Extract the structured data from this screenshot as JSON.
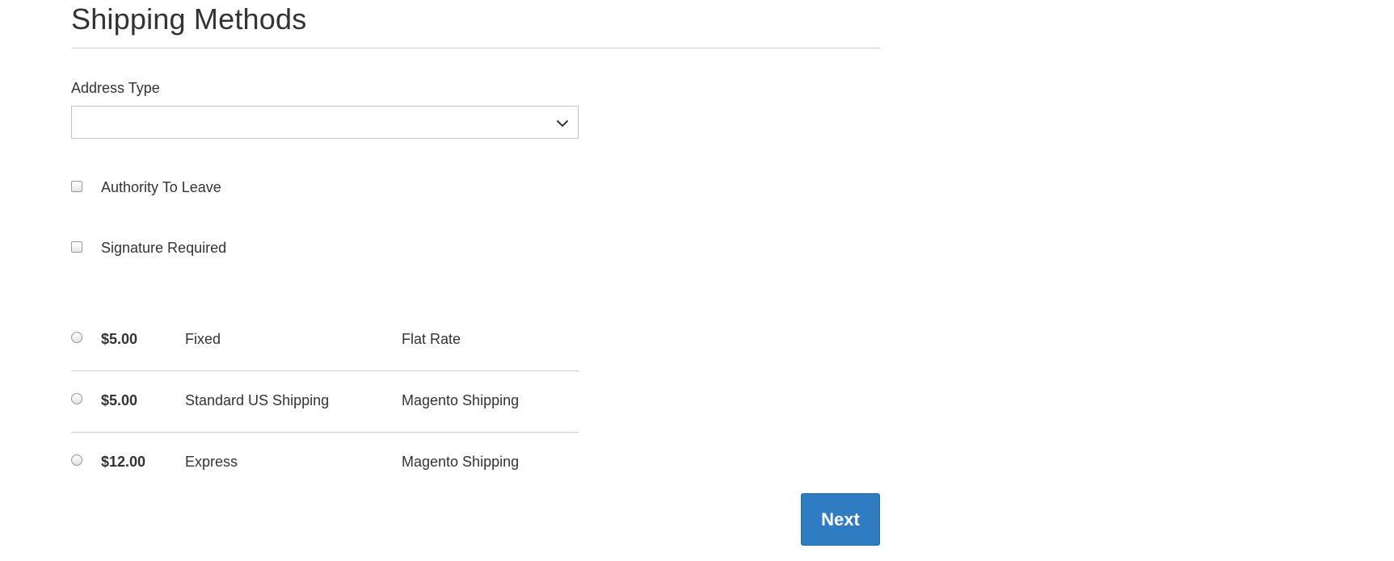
{
  "section": {
    "title": "Shipping Methods"
  },
  "address_type": {
    "label": "Address Type",
    "selected_value": "",
    "icon": "chevron-down-icon"
  },
  "options": {
    "authority_to_leave": {
      "label": "Authority To Leave",
      "checked": false
    },
    "signature_required": {
      "label": "Signature Required",
      "checked": false
    }
  },
  "shipping_rates": [
    {
      "price": "$5.00",
      "method": "Fixed",
      "carrier": "Flat Rate",
      "selected": false
    },
    {
      "price": "$5.00",
      "method": "Standard US Shipping",
      "carrier": "Magento Shipping",
      "selected": false
    },
    {
      "price": "$12.00",
      "method": "Express",
      "carrier": "Magento Shipping",
      "selected": false
    }
  ],
  "actions": {
    "next_label": "Next"
  },
  "colors": {
    "primary_button": "#2f7cc2",
    "text": "#333333",
    "divider": "#cccccc"
  }
}
